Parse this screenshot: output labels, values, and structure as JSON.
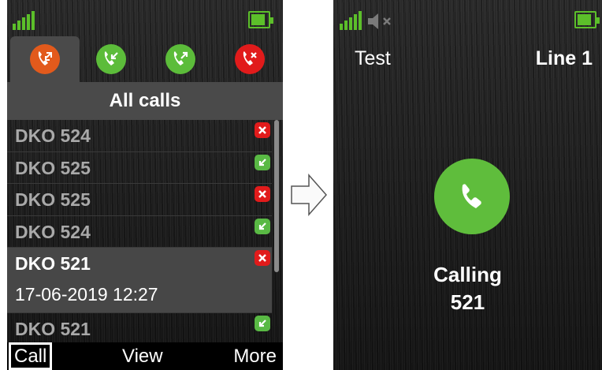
{
  "left_screen": {
    "tabs": [
      {
        "icon": "all-calls-icon",
        "color": "#e25a1c",
        "active": true
      },
      {
        "icon": "incoming-call-icon",
        "color": "#5cbc3a",
        "active": false
      },
      {
        "icon": "outgoing-call-icon",
        "color": "#5cbc3a",
        "active": false
      },
      {
        "icon": "missed-call-icon",
        "color": "#e11b1b",
        "active": false
      }
    ],
    "header": "All calls",
    "calls": [
      {
        "name": "DKO 524",
        "status": "missed"
      },
      {
        "name": "DKO 525",
        "status": "incoming"
      },
      {
        "name": "DKO 525",
        "status": "missed"
      },
      {
        "name": "DKO 524",
        "status": "incoming"
      },
      {
        "name": "DKO 521",
        "status": "missed",
        "date": "17-06-2019 12:27",
        "selected": true
      },
      {
        "name": "DKO 521",
        "status": "incoming"
      }
    ],
    "softkeys": {
      "left": "Call",
      "center": "View",
      "right": "More"
    }
  },
  "right_screen": {
    "title_left": "Test",
    "title_right": "Line 1",
    "call_state": "Calling",
    "call_number": "521"
  },
  "colors": {
    "signal": "#5cbf2a",
    "battery": "#5cbf2a",
    "accept_green": "#5fbd3c",
    "missed_red": "#e11b1b"
  }
}
